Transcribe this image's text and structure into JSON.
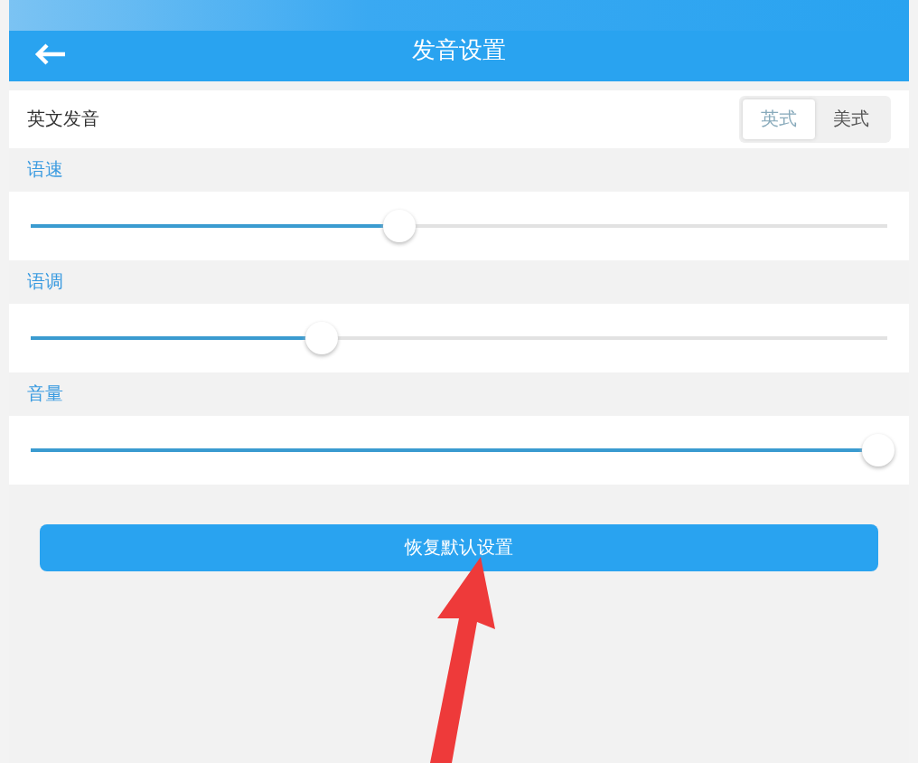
{
  "header": {
    "title": "发音设置"
  },
  "pronunciation": {
    "label": "英文发音",
    "options": [
      {
        "label": "英式",
        "selected": true
      },
      {
        "label": "美式",
        "selected": false
      }
    ]
  },
  "sliders": [
    {
      "label": "语速",
      "level": 0.43
    },
    {
      "label": "语调",
      "level": 0.34
    },
    {
      "label": "音量",
      "level": 0.99
    }
  ],
  "reset_button": "恢复默认设置"
}
